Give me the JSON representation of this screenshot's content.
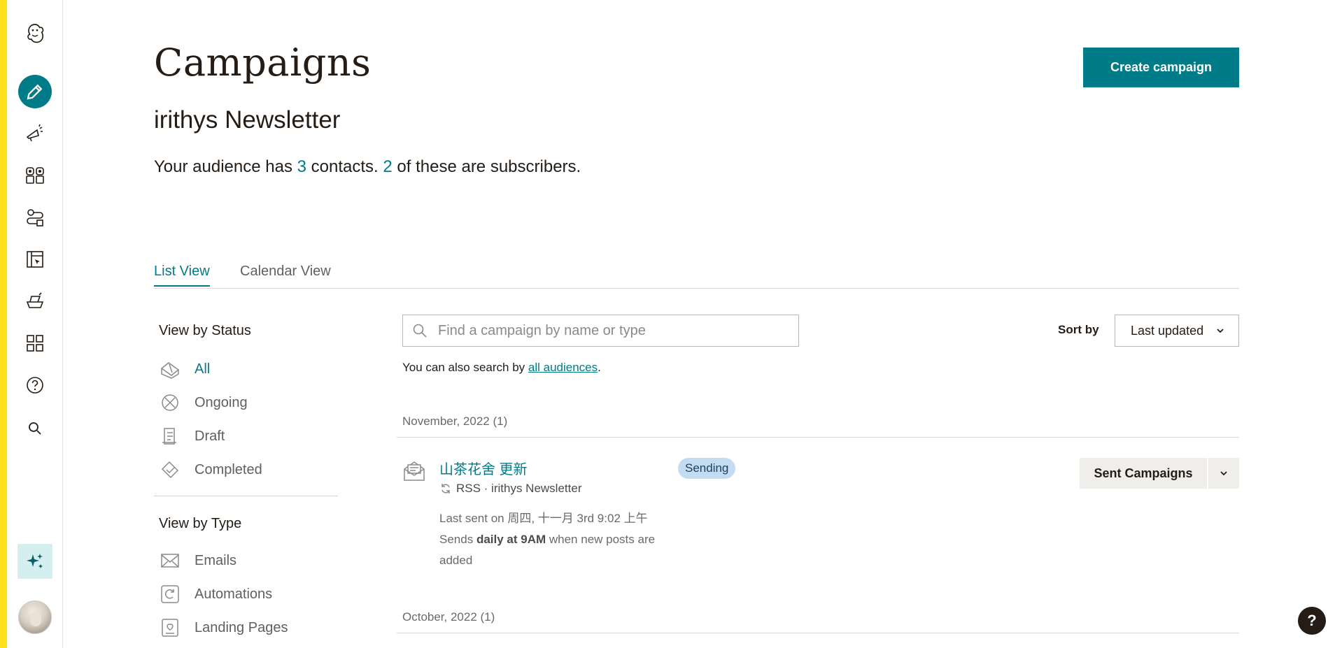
{
  "header": {
    "title": "Campaigns",
    "audience_name": "irithys Newsletter",
    "audience_prefix": "Your audience has",
    "contacts_count": "3",
    "contacts_mid": "contacts.",
    "subscribers_count": "2",
    "subscribers_suffix": "of these are subscribers.",
    "create_label": "Create campaign"
  },
  "tabs": [
    {
      "label": "List View",
      "active": true
    },
    {
      "label": "Calendar View",
      "active": false
    }
  ],
  "status_filter": {
    "heading": "View by Status",
    "items": [
      {
        "label": "All",
        "icon": "all-campaigns-icon",
        "active": true
      },
      {
        "label": "Ongoing",
        "icon": "ongoing-icon"
      },
      {
        "label": "Draft",
        "icon": "draft-icon"
      },
      {
        "label": "Completed",
        "icon": "completed-icon"
      }
    ]
  },
  "type_filter": {
    "heading": "View by Type",
    "items": [
      {
        "label": "Emails",
        "icon": "email-icon"
      },
      {
        "label": "Automations",
        "icon": "automation-icon"
      },
      {
        "label": "Landing Pages",
        "icon": "landing-page-icon"
      }
    ]
  },
  "search": {
    "placeholder": "Find a campaign by name or type",
    "hint_prefix": "You can also search by",
    "hint_link": "all audiences",
    "hint_suffix": "."
  },
  "sort": {
    "label": "Sort by",
    "value": "Last updated"
  },
  "groups": [
    {
      "month": "November, 2022 (1)",
      "campaign": {
        "name": "山茶花舍 更新",
        "status": "Sending",
        "meta": "RSS · irithys Newsletter",
        "last_sent": "Last sent on 周四, 十一月 3rd 9:02 上午",
        "sends_prefix": "Sends",
        "sends_bold": "daily at 9AM",
        "sends_suffix": "when new posts are added",
        "action_label": "Sent Campaigns"
      }
    },
    {
      "month": "October, 2022 (1)"
    }
  ],
  "help": {
    "label": "?"
  },
  "colors": {
    "accent": "#007c89",
    "strip": "#ffe01b",
    "badge": "#c4dcf1"
  }
}
